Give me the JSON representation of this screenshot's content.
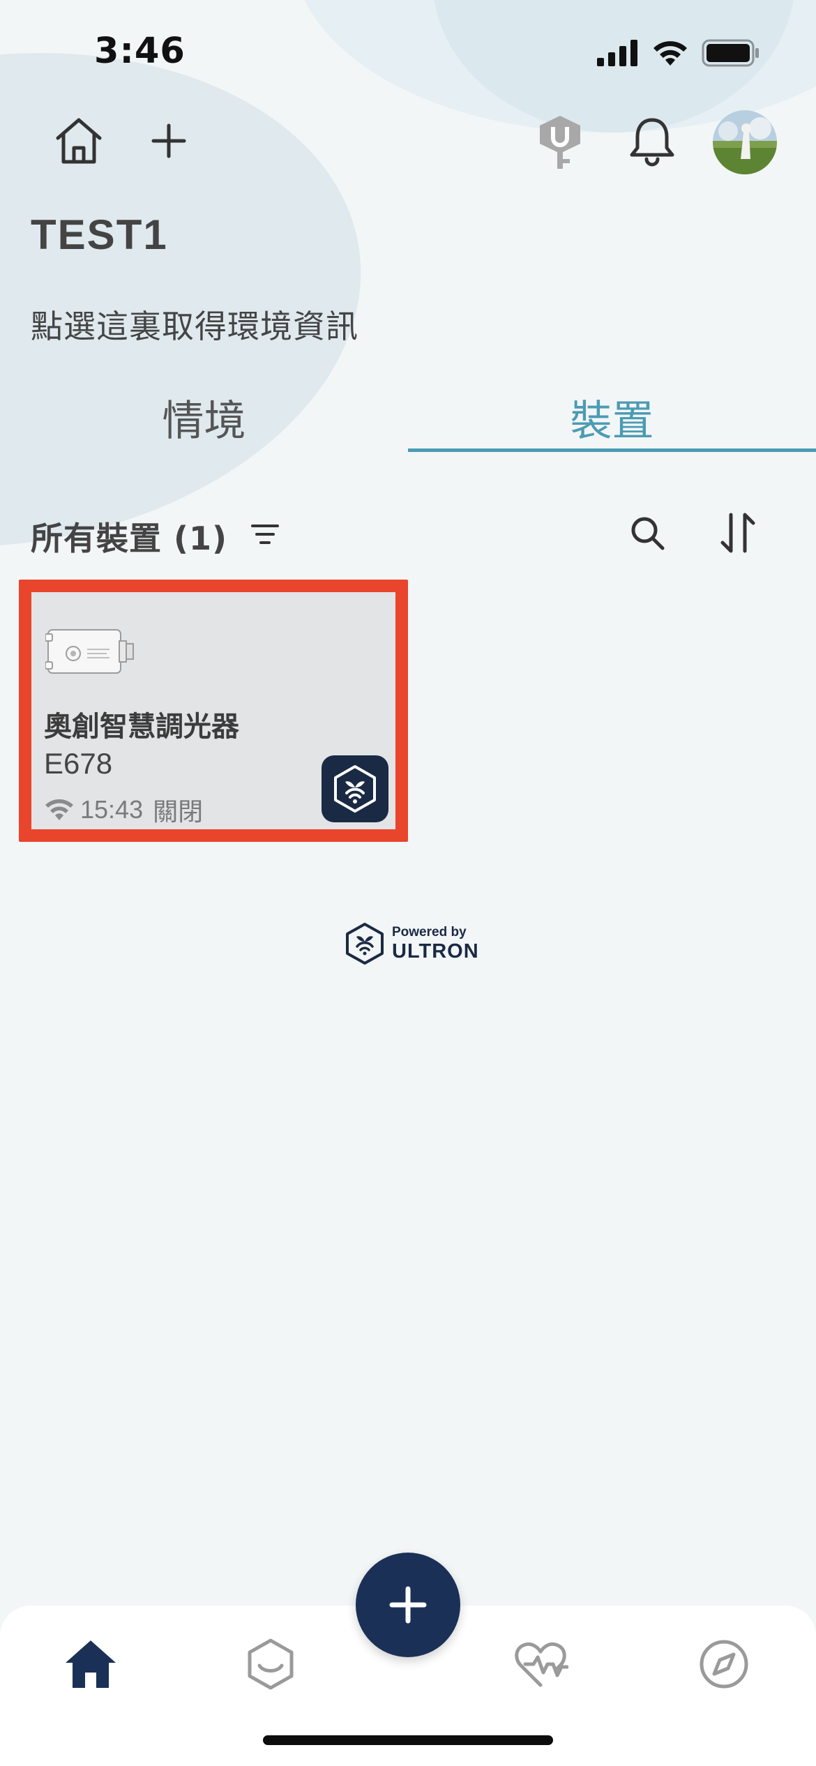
{
  "status_bar": {
    "time": "3:46",
    "signal_icon": "cellular-signal-icon",
    "wifi_icon": "wifi-icon",
    "battery_icon": "battery-icon"
  },
  "header": {
    "home_icon": "home-icon",
    "add_icon": "plus-icon",
    "key_icon": "ultron-key-icon",
    "bell_icon": "bell-icon",
    "avatar": "user-avatar"
  },
  "home": {
    "title": "TEST1",
    "env_hint": "點選這裏取得環境資訊"
  },
  "tabs": [
    {
      "label": "情境",
      "active": false
    },
    {
      "label": "裝置",
      "active": true
    }
  ],
  "device_list": {
    "header": "所有裝置 (1)",
    "filter_icon": "filter-icon",
    "search_icon": "search-icon",
    "sort_icon": "sort-icon",
    "devices": [
      {
        "name": "奧創智慧調光器",
        "id": "E678",
        "time": "15:43",
        "state": "關閉",
        "connection_icon": "wifi-icon",
        "badge_icon": "ultron-hub-icon"
      }
    ]
  },
  "powered_by": {
    "line1": "Powered by",
    "line2": "ULTRON"
  },
  "bottom_nav": {
    "items": [
      {
        "icon": "home-icon",
        "active": true
      },
      {
        "icon": "scene-icon",
        "active": false
      },
      {
        "icon": "add-icon",
        "active": false
      },
      {
        "icon": "health-icon",
        "active": false
      },
      {
        "icon": "explore-icon",
        "active": false
      }
    ]
  },
  "colors": {
    "accent": "#4b9bb4",
    "navy": "#1a3056",
    "highlight_border": "#e8452c",
    "background": "#f3f6f7"
  }
}
